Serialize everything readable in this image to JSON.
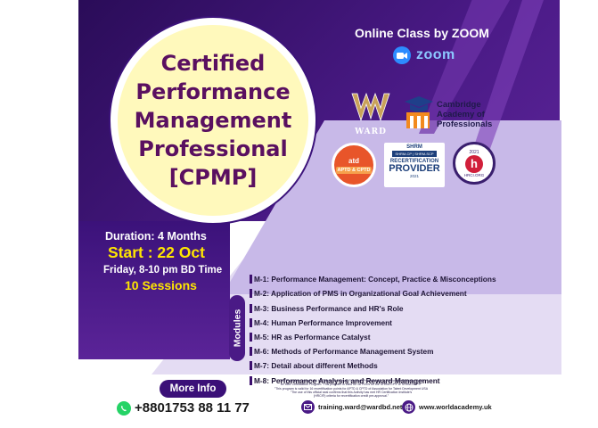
{
  "title_lines": [
    "Certified",
    "Performance",
    "Management",
    "Professional",
    "[CPMP]"
  ],
  "online": {
    "text": "Online Class by ZOOM",
    "zoom_word": "zoom"
  },
  "logos": {
    "ward": "WARD",
    "cambridge": [
      "Cambridge",
      "Academy of",
      "Professionals"
    ],
    "atd": {
      "top": "atd",
      "badge": "APTD & CPTD"
    },
    "shrm": {
      "top": "SHRM",
      "certs": "SHRM-CP | SHRM-SCP",
      "recert": "RECERTIFICATION",
      "provider": "PROVIDER",
      "year": "2021"
    },
    "hrci": {
      "year": "2021",
      "mark": "h",
      "name": "HRCI.ORG"
    }
  },
  "schedule": {
    "duration": "Duration:  4 Months",
    "start": "Start : 22 Oct",
    "time": "Friday, 8-10 pm  BD Time",
    "sessions": "10 Sessions"
  },
  "modules_label": "Modules",
  "modules": [
    "M-1: Performance Management: Concept, Practice & Misconceptions",
    "M-2: Application of PMS in Organizational Goal Achievement",
    "M-3: Business Performance and HR's Role",
    "M-4: Human Performance Improvement",
    "M-5: HR as Performance Catalyst",
    "M-6: Methods of Performance Management System",
    "M-7: Detail about different Methods",
    "M-8: Performance Analysis and Reward Management"
  ],
  "more_info": "More Info",
  "fine_print": [
    "This Program is recognized by Society for Human Resource Professionals - USA for recertification credit",
    "for their Certification Program \"This program is valid for 16 PDCs for the SHRM-CP® or SHRM-SCP®\"",
    "\"This program is valid for 16 recertification points for APTD & CPTD of Association for Talent Development USA",
    "\"The use of this official seal confirms that this Activity has met HR Certification Institute's",
    "(HRCI®) criteria for recertification credit pre-approval.\""
  ],
  "contact": {
    "phone": "+8801753 88 11 77",
    "email": "training.ward@wardbd.net",
    "website": "www.worldacademy.uk"
  },
  "colors": {
    "purple_dark": "#3b127a",
    "title_text": "#5a1060",
    "circle_fill": "#fff9bc",
    "accent_yellow": "#ffe600",
    "lavender": "#c8b9e8",
    "zoom_blue": "#2d8cff"
  }
}
